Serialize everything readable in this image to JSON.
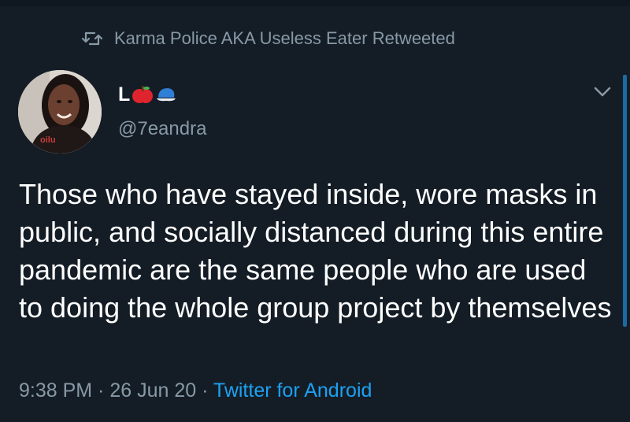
{
  "retweet": {
    "label": "Karma Police AKA Useless Eater Retweeted"
  },
  "author": {
    "display_name": "L",
    "handle": "@7eandra",
    "emojis": [
      "red-apple-icon",
      "blue-cap-icon"
    ]
  },
  "tweet": {
    "text": "Those who have stayed inside, wore masks in public, and socially distanced during this entire pandemic are the same people who are used to doing the whole group project by themselves"
  },
  "meta": {
    "time": "9:38 PM",
    "separator": " · ",
    "date": "26 Jun 20",
    "separator2": " · ",
    "source": "Twitter for Android"
  },
  "colors": {
    "background": "#141d26",
    "muted_text": "#8899a6",
    "link": "#1da1f2"
  }
}
